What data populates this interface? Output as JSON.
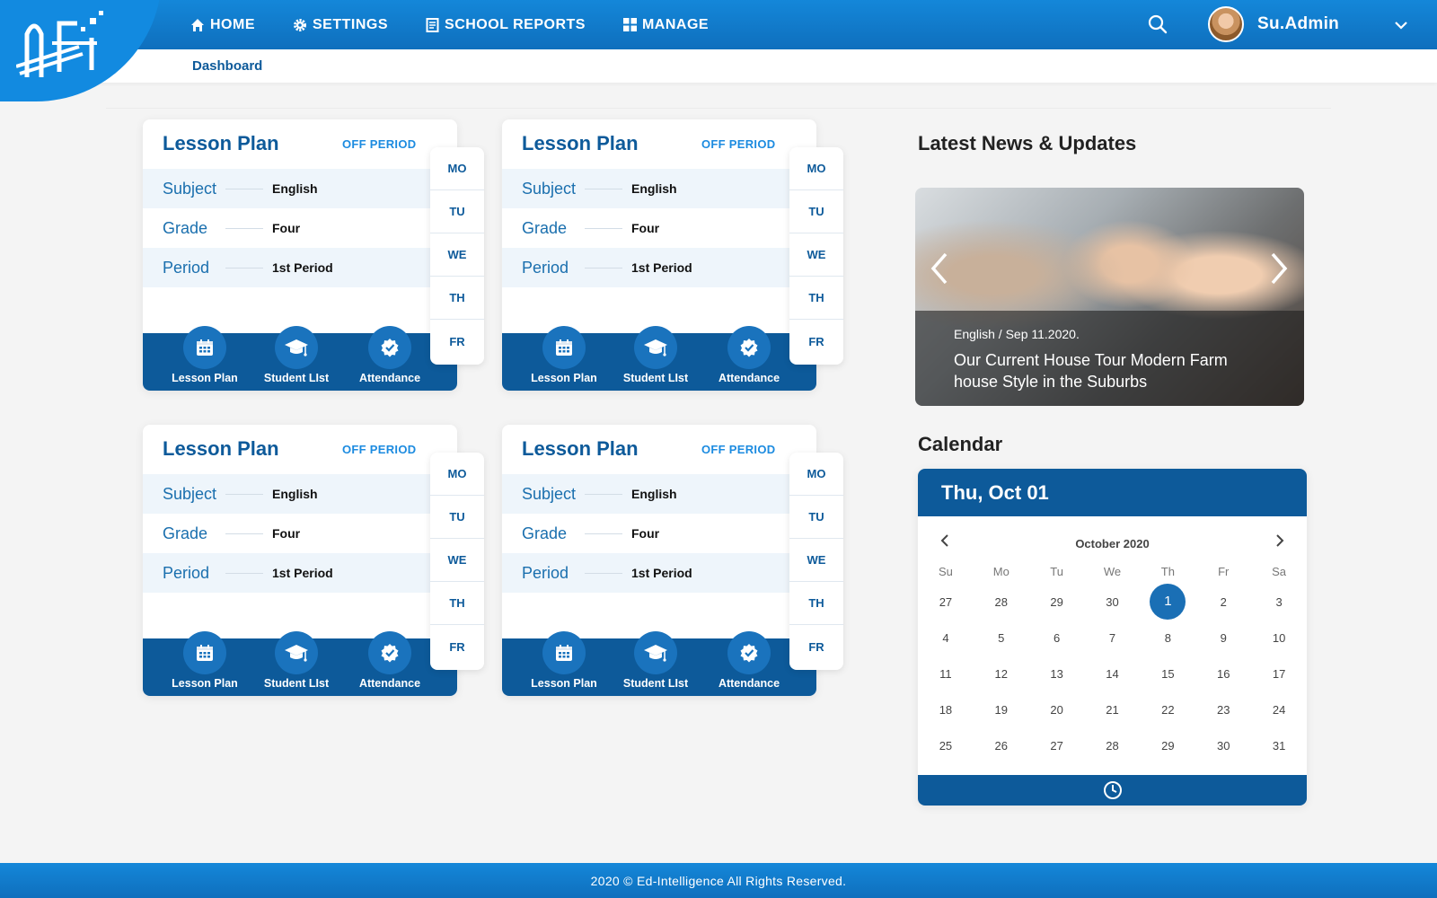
{
  "nav": {
    "home": "HOME",
    "settings": "SETTINGS",
    "reports": "SCHOOL REPORTS",
    "manage": "MANAGE"
  },
  "user": {
    "name": "Su.Admin"
  },
  "breadcrumb": "Dashboard",
  "cards": [
    {
      "title": "Lesson Plan",
      "badge": "OFF PERIOD",
      "subject_label": "Subject",
      "subject": "English",
      "grade_label": "Grade",
      "grade": "Four",
      "period_label": "Period",
      "period": "1st Period"
    },
    {
      "title": "Lesson Plan",
      "badge": "OFF PERIOD",
      "subject_label": "Subject",
      "subject": "English",
      "grade_label": "Grade",
      "grade": "Four",
      "period_label": "Period",
      "period": "1st Period"
    },
    {
      "title": "Lesson Plan",
      "badge": "OFF PERIOD",
      "subject_label": "Subject",
      "subject": "English",
      "grade_label": "Grade",
      "grade": "Four",
      "period_label": "Period",
      "period": "1st Period"
    },
    {
      "title": "Lesson Plan",
      "badge": "OFF PERIOD",
      "subject_label": "Subject",
      "subject": "English",
      "grade_label": "Grade",
      "grade": "Four",
      "period_label": "Period",
      "period": "1st Period"
    }
  ],
  "card_actions": {
    "lesson_plan": "Lesson Plan",
    "student_list": "Student LIst",
    "attendance": "Attendance"
  },
  "weekdays": [
    "MO",
    "TU",
    "WE",
    "TH",
    "FR"
  ],
  "news": {
    "heading": "Latest News & Updates",
    "meta": "English / Sep 11.2020.",
    "title": "Our Current House Tour Modern Farm house Style in the Suburbs"
  },
  "calendar": {
    "heading": "Calendar",
    "selected_label": "Thu, Oct 01",
    "month": "October 2020",
    "dow": [
      "Su",
      "Mo",
      "Tu",
      "We",
      "Th",
      "Fr",
      "Sa"
    ],
    "weeks": [
      [
        "27",
        "28",
        "29",
        "30",
        "1",
        "2",
        "3"
      ],
      [
        "4",
        "5",
        "6",
        "7",
        "8",
        "9",
        "10"
      ],
      [
        "11",
        "12",
        "13",
        "14",
        "15",
        "16",
        "17"
      ],
      [
        "18",
        "19",
        "20",
        "21",
        "22",
        "23",
        "24"
      ],
      [
        "25",
        "26",
        "27",
        "28",
        "29",
        "30",
        "31"
      ]
    ],
    "selected": "1"
  },
  "footer": "2020 © Ed-Intelligence All Rights Reserved.",
  "colors": {
    "brand": "#0d5a9a",
    "accent": "#1487d9"
  }
}
